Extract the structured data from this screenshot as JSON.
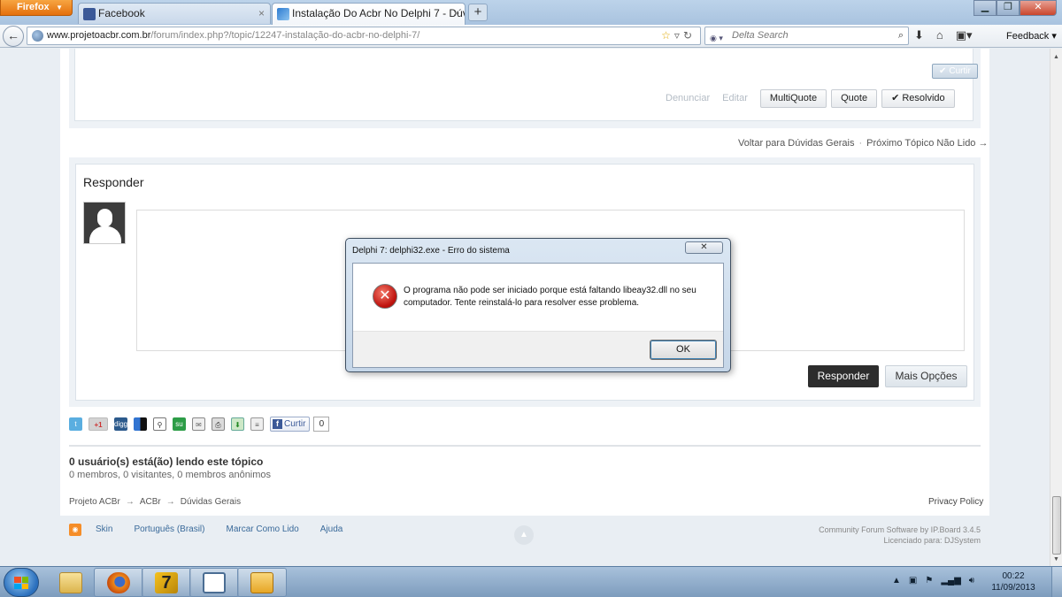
{
  "browser": {
    "menu_button": "Firefox",
    "tabs": [
      {
        "title": "Facebook",
        "active": false
      },
      {
        "title": "Instalação Do Acbr No Delphi 7 - Dúv...",
        "active": true
      }
    ],
    "url_host": "www.projetoacbr.com.br",
    "url_path": "/forum/index.php?/topic/12247-instalação-do-acbr-no-delphi-7/",
    "search_placeholder": "Delta Search",
    "feedback_label": "Feedback"
  },
  "post": {
    "like_label": "Curtir",
    "report_label": "Denunciar",
    "edit_label": "Editar",
    "multiquote_label": "MultiQuote",
    "quote_label": "Quote",
    "solved_label": "Resolvido"
  },
  "topic_nav": {
    "back_label": "Voltar para Dúvidas Gerais",
    "separator": "·",
    "next_label": "Próximo Tópico Não Lido →"
  },
  "reply": {
    "title": "Responder",
    "submit_label": "Responder",
    "more_options_label": "Mais Opções"
  },
  "share": {
    "gplus_label": "+1",
    "digg_label": "digg",
    "like_label": "Curtir",
    "like_count": "0"
  },
  "readers": {
    "title": "0 usuário(s) está(ão) lendo este tópico",
    "subtitle": "0 membros, 0 visitantes, 0 membros anônimos"
  },
  "breadcrumb": {
    "items": [
      "Projeto ACBr",
      "ACBr",
      "Dúvidas Gerais"
    ],
    "arrow": "→"
  },
  "privacy_label": "Privacy Policy",
  "footer": {
    "links": [
      "Skin",
      "Português (Brasil)",
      "Marcar Como Lido",
      "Ajuda"
    ],
    "credit_line1": "Community Forum Software by IP.Board 3.4.5",
    "credit_line2": "Licenciado para: DJSystem"
  },
  "dialog": {
    "title": "Delphi 7: delphi32.exe - Erro do sistema",
    "message": "O programa não pode ser iniciado porque está faltando libeay32.dll no seu computador. Tente reinstalá-lo para resolver esse problema.",
    "ok_label": "OK"
  },
  "taskbar": {
    "time": "00:22",
    "date": "11/09/2013"
  },
  "colors": {
    "firefox_orange": "#e46f0c",
    "reply_button": "#2d2d2d",
    "error_red": "#c0140f",
    "taskbar_blue": "#7d9cbd"
  }
}
